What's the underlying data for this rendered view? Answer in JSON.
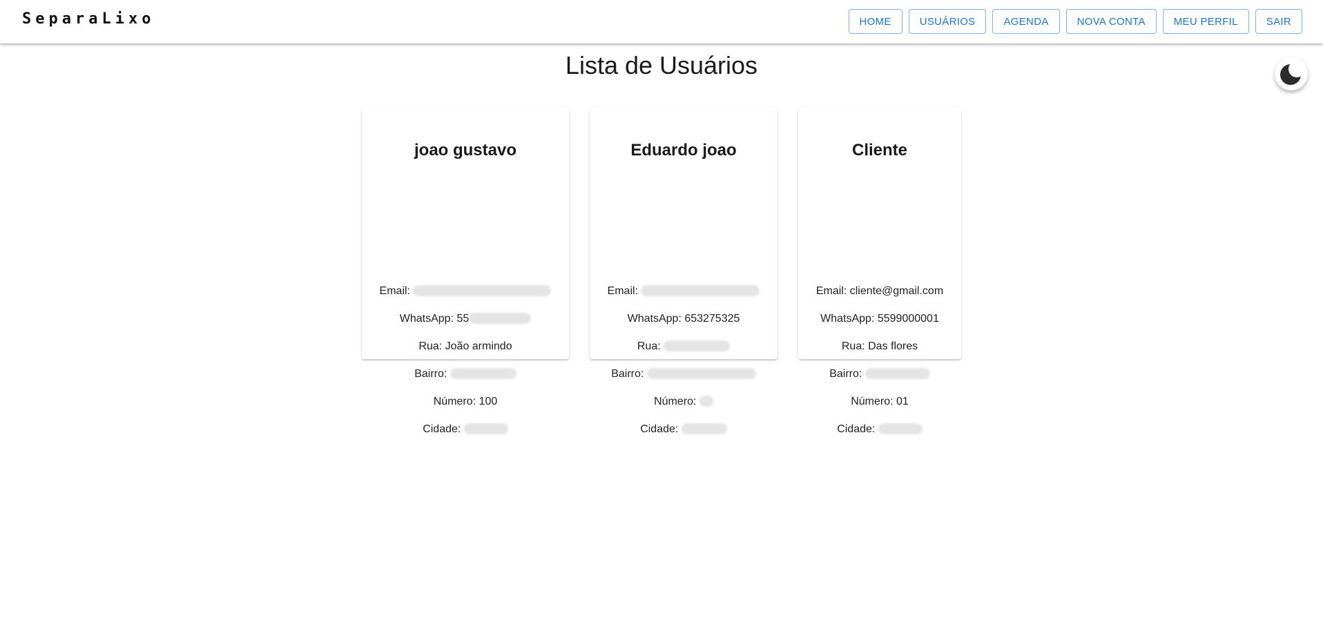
{
  "header": {
    "brand": "SeparaLixo",
    "nav": [
      "HOME",
      "USUÁRIOS",
      "AGENDA",
      "NOVA CONTA",
      "MEU PERFIL",
      "SAIR"
    ]
  },
  "theme_toggle": {
    "icon": "moon-icon"
  },
  "page_title": "Lista de Usuários",
  "users": [
    {
      "name": "joao gustavo",
      "email_label": "Email:",
      "whatsapp_label": "WhatsApp:",
      "whatsapp_value": "55",
      "rua_label": "Rua:",
      "rua_value": "João armindo",
      "bairro_label": "Bairro:",
      "numero_label": "Número:",
      "numero_value": "100",
      "cidade_label": "Cidade:"
    },
    {
      "name": "Eduardo joao",
      "email_label": "Email:",
      "whatsapp_label": "WhatsApp:",
      "whatsapp_value": "653275325",
      "rua_label": "Rua:",
      "bairro_label": "Bairro:",
      "numero_label": "Número:",
      "cidade_label": "Cidade:"
    },
    {
      "name": "Cliente",
      "email_label": "Email:",
      "email_value": "cliente@gmail.com",
      "whatsapp_label": "WhatsApp:",
      "whatsapp_value": "5599000001",
      "rua_label": "Rua:",
      "rua_value": "Das flores",
      "bairro_label": "Bairro:",
      "numero_label": "Número:",
      "numero_value": "01",
      "cidade_label": "Cidade:"
    }
  ]
}
